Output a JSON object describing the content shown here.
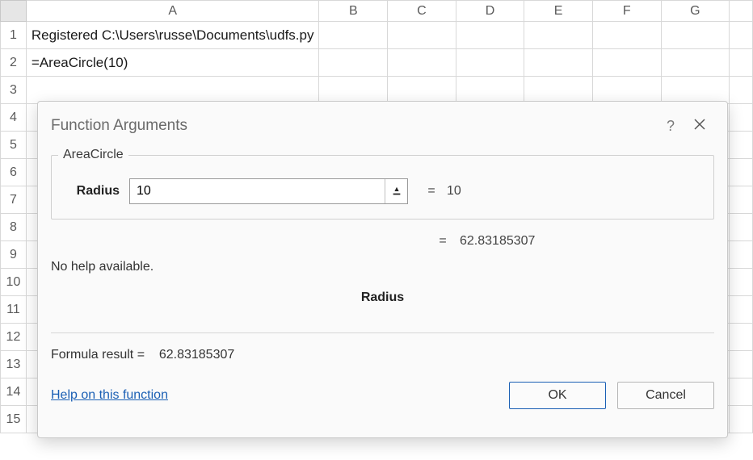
{
  "sheet": {
    "columns": [
      "A",
      "B",
      "C",
      "D",
      "E",
      "F",
      "G"
    ],
    "row_headers": [
      "1",
      "2",
      "3",
      "4",
      "5",
      "6",
      "7",
      "8",
      "9",
      "10",
      "11",
      "12",
      "13",
      "14",
      "15"
    ],
    "cells": {
      "A1": "Registered C:\\Users\\russe\\Documents\\udfs.py",
      "A2": "=AreaCircle(10)"
    }
  },
  "dialog": {
    "title": "Function Arguments",
    "function_name": "AreaCircle",
    "arg": {
      "label": "Radius",
      "value": "10",
      "eq1": "=",
      "evaluated": "10"
    },
    "result": {
      "eq": "=",
      "value": "62.83185307"
    },
    "help_text": "No help available.",
    "current_arg_name": "Radius",
    "formula_result_label": "Formula result =",
    "formula_result_value": "62.83185307",
    "help_link": "Help on this function",
    "ok_label": "OK",
    "cancel_label": "Cancel",
    "help_icon": "?"
  }
}
